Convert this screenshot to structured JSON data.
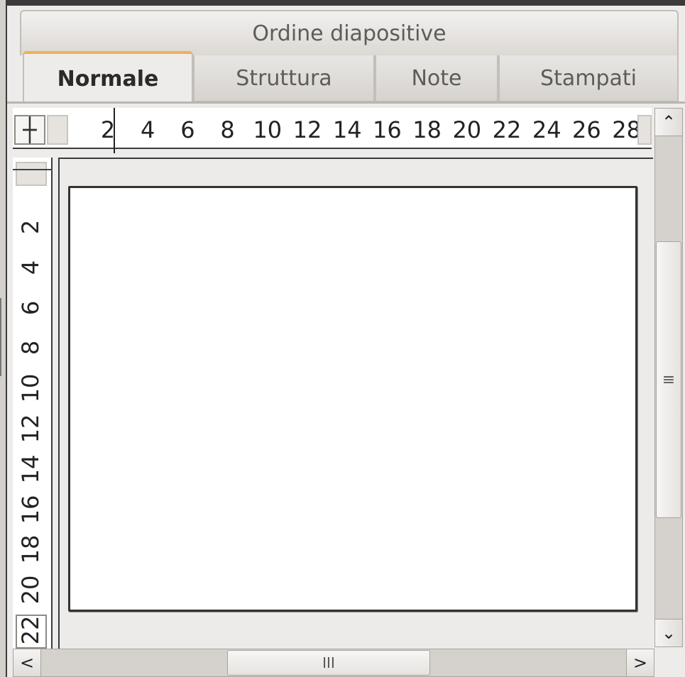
{
  "tabs": {
    "top_label": "Ordine diapositive",
    "items": [
      {
        "label": "Normale",
        "active": true
      },
      {
        "label": "Struttura",
        "active": false
      },
      {
        "label": "Note",
        "active": false
      },
      {
        "label": "Stampati",
        "active": false
      }
    ],
    "active_accent": "#f0b057"
  },
  "ruler": {
    "origin_icon": "crosshair-icon",
    "horizontal_ticks": [
      "2",
      "4",
      "6",
      "8",
      "10",
      "12",
      "14",
      "16",
      "18",
      "20",
      "22",
      "24",
      "26",
      "28"
    ],
    "vertical_ticks": [
      "2",
      "4",
      "6",
      "8",
      "10",
      "12",
      "14",
      "16",
      "18",
      "20",
      "22"
    ]
  },
  "scrollbars": {
    "up_icon": "chevron-up-icon",
    "down_icon": "chevron-down-icon",
    "left_icon": "chevron-left-icon",
    "right_icon": "chevron-right-icon",
    "vertical_grip": "≡",
    "horizontal_grip": "III",
    "up_glyph": "⌃",
    "down_glyph": "⌄",
    "left_glyph": "<",
    "right_glyph": ">"
  }
}
